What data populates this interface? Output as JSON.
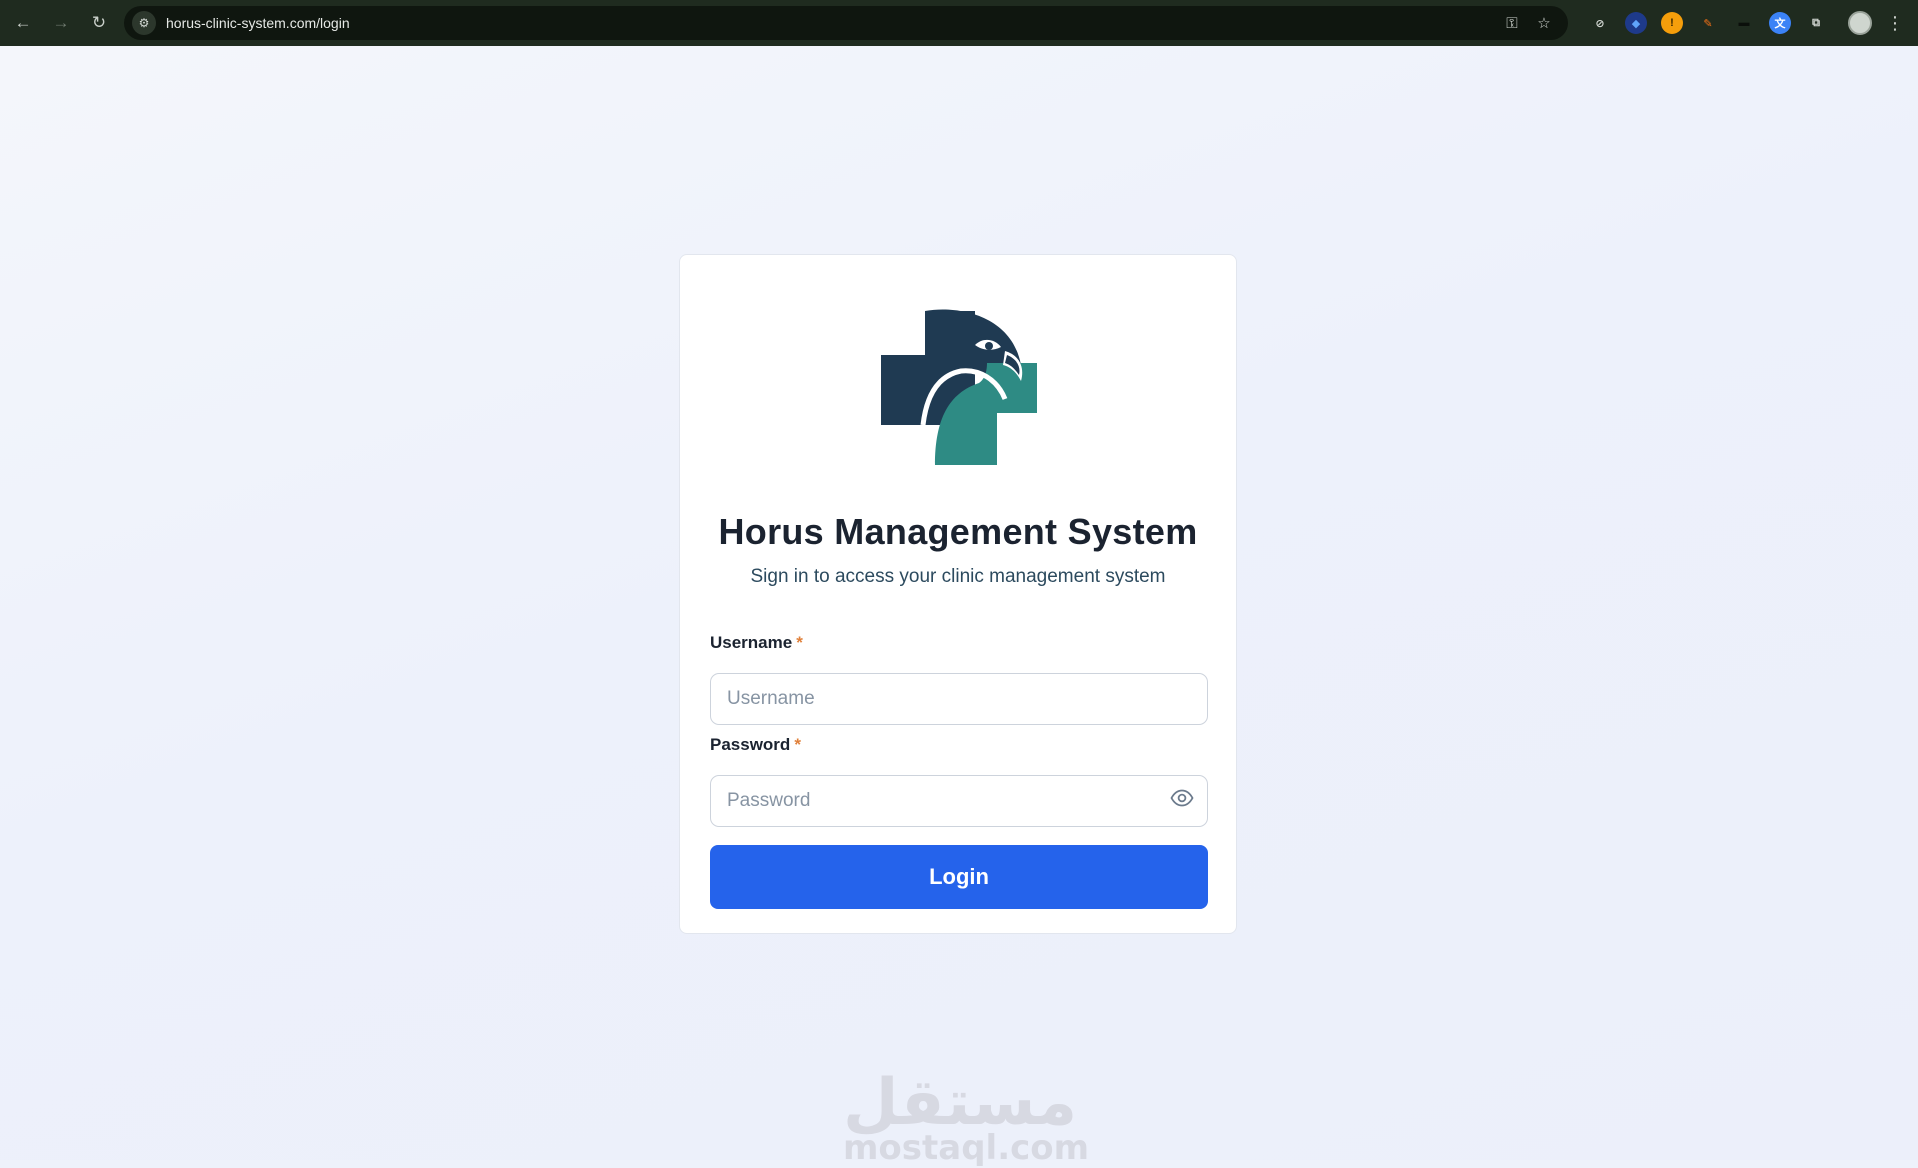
{
  "browser": {
    "url": "horus-clinic-system.com/login",
    "nav": {
      "back_icon": "←",
      "forward_icon": "→",
      "reload_icon": "↻"
    },
    "site_info_icon": "⚙",
    "omnibox_icons": {
      "password_icon": "⚿",
      "bookmark_icon": "☆"
    },
    "extensions": [
      {
        "name": "compass-icon",
        "glyph": "⊘",
        "bg": "transparent",
        "color": "#d4d9d4"
      },
      {
        "name": "extension-blue-icon",
        "glyph": "◆",
        "bg": "#1e3a8a",
        "color": "#60a5fa"
      },
      {
        "name": "extension-orange-icon",
        "glyph": "!",
        "bg": "#f59e0b",
        "color": "#3a2600"
      },
      {
        "name": "eraser-icon",
        "glyph": "✎",
        "bg": "transparent",
        "color": "#f97316"
      },
      {
        "name": "extension-dark-icon",
        "glyph": "▬",
        "bg": "transparent",
        "color": "#0b0f0b"
      },
      {
        "name": "translate-icon",
        "glyph": "文",
        "bg": "#3b82f6",
        "color": "#ffffff"
      },
      {
        "name": "puzzle-icon",
        "glyph": "⧉",
        "bg": "transparent",
        "color": "#d4d9d4"
      }
    ],
    "menu_icon": "⋮"
  },
  "login": {
    "title": "Horus Management System",
    "subtitle": "Sign in to access your clinic management system",
    "username_label": "Username",
    "username_placeholder": "Username",
    "username_value": "",
    "password_label": "Password",
    "password_placeholder": "Password",
    "password_value": "",
    "required_mark": "*",
    "login_button": "Login"
  },
  "watermark": {
    "arabic": "مستقل",
    "latin": "mostaql.com"
  },
  "colors": {
    "primary": "#2563eb",
    "logo_dark": "#1f3a52",
    "logo_teal": "#2e8b84",
    "required": "#e0803a"
  }
}
